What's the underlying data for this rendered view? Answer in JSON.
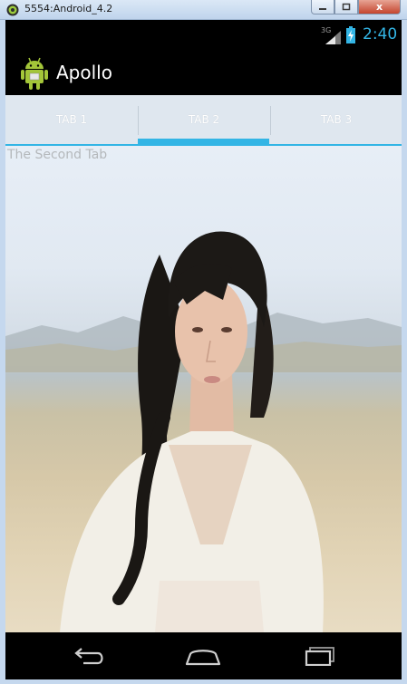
{
  "window": {
    "title": "5554:Android_4.2",
    "close_label": "x"
  },
  "status_bar": {
    "network": "3G",
    "time": "2:40"
  },
  "action_bar": {
    "app_name": "Apollo"
  },
  "tabs": [
    {
      "label": "TAB 1",
      "selected": false
    },
    {
      "label": "TAB 2",
      "selected": true
    },
    {
      "label": "TAB 3",
      "selected": false
    }
  ],
  "content": {
    "label": "The Second Tab"
  },
  "colors": {
    "accent": "#33b5e5",
    "status_time": "#33b5e5",
    "tab_bar_bg": "#dfe7ef"
  },
  "icons": {
    "app_logo": "android-robot-icon",
    "signal": "signal-icon",
    "battery": "battery-icon",
    "back": "back-icon",
    "home": "home-icon",
    "recent": "recent-apps-icon"
  }
}
